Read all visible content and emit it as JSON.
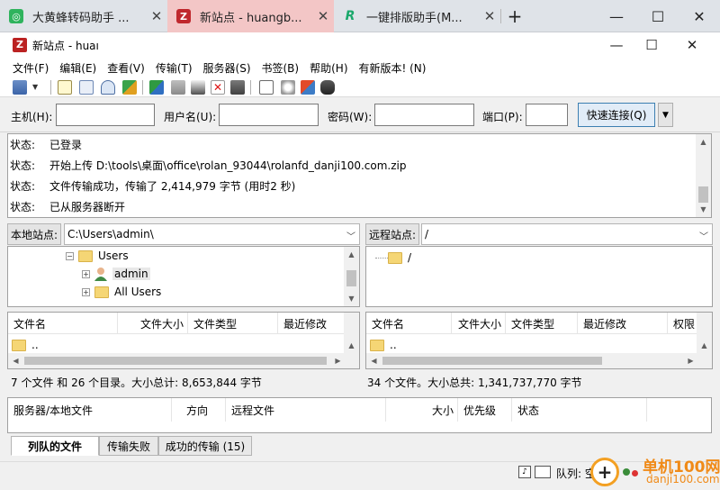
{
  "browser": {
    "tabs": [
      {
        "label": "大黄蜂转码助手 ...",
        "active": false
      },
      {
        "label": "新站点 - huangb...",
        "active": true
      },
      {
        "label": "一键排版助手(M...",
        "active": false
      }
    ],
    "new_tab": "+",
    "close_glyph": "✕",
    "window": {
      "min": "—",
      "max": "☐",
      "close": "✕"
    }
  },
  "app": {
    "title": "新站点 - huaı",
    "icon": "filezilla-icon",
    "brand_color": "#b22222"
  },
  "menu": [
    "文件(F)",
    "编辑(E)",
    "查看(V)",
    "传输(T)",
    "服务器(S)",
    "书签(B)",
    "帮助(H)",
    "有新版本! (N)"
  ],
  "quickconnect": {
    "host_label": "主机(H):",
    "user_label": "用户名(U):",
    "pass_label": "密码(W):",
    "port_label": "端口(P):",
    "host_value": "",
    "user_value": "",
    "pass_value": "",
    "port_value": "",
    "connect_button": "快速连接(Q)",
    "dropdown": "▼"
  },
  "log": [
    {
      "kind": "状态:",
      "text": "已登录"
    },
    {
      "kind": "状态:",
      "text": "开始上传 D:\\tools\\桌面\\office\\rolan_93044\\rolanfd_danji100.com.zip"
    },
    {
      "kind": "状态:",
      "text": "文件传输成功，传输了 2,414,979 字节 (用时2 秒)"
    },
    {
      "kind": "状态:",
      "text": "已从服务器断开"
    }
  ],
  "local": {
    "site_label": "本地站点:",
    "path": "C:\\Users\\admin\\",
    "tree": [
      {
        "label": "Users",
        "expander": "−",
        "icon": "folder"
      },
      {
        "label": "admin",
        "expander": "+",
        "icon": "user"
      },
      {
        "label": "All Users",
        "expander": "+",
        "icon": "folder"
      }
    ],
    "columns": [
      "文件名",
      "文件大小",
      "文件类型",
      "最近修改"
    ],
    "rows": [
      {
        "name": ".."
      }
    ],
    "summary": "7 个文件 和 26 个目录。大小总计: 8,653,844 字节"
  },
  "remote": {
    "site_label": "远程站点:",
    "path": "/",
    "tree": [
      {
        "label": "/"
      }
    ],
    "columns": [
      "文件名",
      "文件大小",
      "文件类型",
      "最近修改",
      "权限"
    ],
    "rows": [
      {
        "name": ".."
      }
    ],
    "summary": "34 个文件。大小总共: 1,341,737,770 字节"
  },
  "queue": {
    "columns": [
      "服务器/本地文件",
      "方向",
      "远程文件",
      "大小",
      "优先级",
      "状态"
    ],
    "tabs": [
      "列队的文件",
      "传输失败",
      "成功的传输 (15)"
    ],
    "active_tab": 0
  },
  "statusbar": {
    "queue_label": "队列: 空"
  },
  "watermark": {
    "text": "单机100网",
    "sub": "danji100.com",
    "symbol": "+"
  }
}
